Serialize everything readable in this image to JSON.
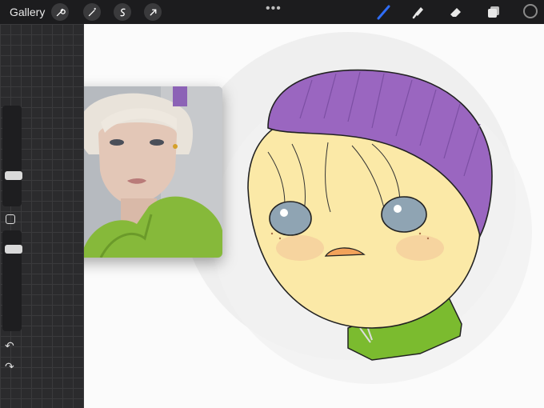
{
  "topbar": {
    "gallery_label": "Gallery",
    "left_tools": [
      "wrench-icon",
      "magic-wand-icon",
      "selection-icon",
      "transform-arrow-icon"
    ],
    "more_menu": "•••",
    "right_tools": [
      "brush-icon",
      "smudge-icon",
      "eraser-icon",
      "layers-icon",
      "color-swatch"
    ],
    "active_color": "#1c1c1e",
    "accent_color": "#2f6df6"
  },
  "sidebar": {
    "brush_size_level": 0.71,
    "opacity_level": 0.16,
    "modify_button": "square-icon",
    "undo_icon": "undo-icon",
    "redo_icon": "redo-icon"
  },
  "canvas": {
    "reference_image": "portrait-photo",
    "drawing": "chibi-sketch"
  }
}
